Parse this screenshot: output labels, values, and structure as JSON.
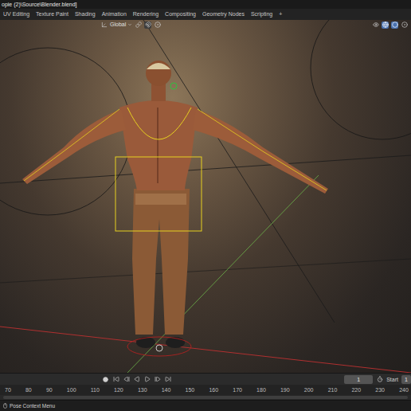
{
  "window": {
    "title": "opie (2)\\Source\\Blender.blend]"
  },
  "workspace_tabs": [
    {
      "label": "UV Editing",
      "selected": false
    },
    {
      "label": "Texture Paint",
      "selected": false
    },
    {
      "label": "Shading",
      "selected": false
    },
    {
      "label": "Animation",
      "selected": false
    },
    {
      "label": "Rendering",
      "selected": false
    },
    {
      "label": "Compositing",
      "selected": false
    },
    {
      "label": "Geometry Nodes",
      "selected": false
    },
    {
      "label": "Scripting",
      "selected": false
    }
  ],
  "add_tab": "+",
  "viewport_header": {
    "orientation": "Global"
  },
  "timeline": {
    "current_frame": "1",
    "start_label": "Start",
    "start_value": "1",
    "ruler": [
      "70",
      "80",
      "90",
      "100",
      "110",
      "120",
      "130",
      "140",
      "150",
      "160",
      "170",
      "180",
      "190",
      "200",
      "210",
      "220",
      "230",
      "240"
    ]
  },
  "status_bar": {
    "hint": "Pose Context Menu"
  }
}
